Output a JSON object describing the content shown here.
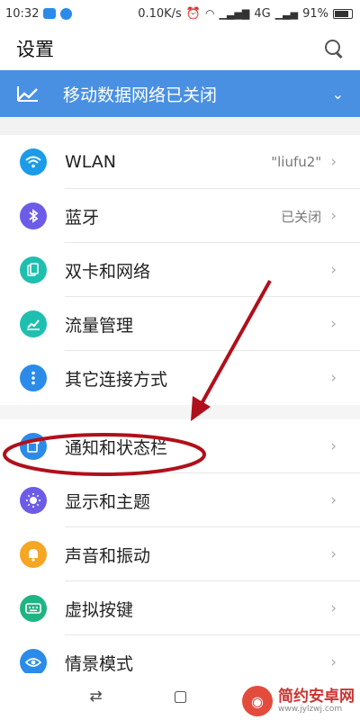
{
  "status_bar": {
    "time": "10:32",
    "speed": "0.10K/s",
    "network": "4G",
    "battery": "91%"
  },
  "header": {
    "title": "设置"
  },
  "banner": {
    "label": "移动数据网络已关闭"
  },
  "settings": {
    "items": [
      {
        "label": "WLAN",
        "value": "\"liufu2\"",
        "icon": "wifi-icon",
        "color": "#1b9be8"
      },
      {
        "label": "蓝牙",
        "value": "已关闭",
        "icon": "bluetooth-icon",
        "color": "#6c5ce7"
      },
      {
        "label": "双卡和网络",
        "value": "",
        "icon": "sim-icon",
        "color": "#1fbfb0"
      },
      {
        "label": "流量管理",
        "value": "",
        "icon": "chart-icon",
        "color": "#1fbfb0"
      },
      {
        "label": "其它连接方式",
        "value": "",
        "icon": "more-icon",
        "color": "#2b8be8"
      },
      {
        "label": "通知和状态栏",
        "value": "",
        "icon": "notification-icon",
        "color": "#2b8be8"
      },
      {
        "label": "显示和主题",
        "value": "",
        "icon": "brightness-icon",
        "color": "#6c5ce7"
      },
      {
        "label": "声音和振动",
        "value": "",
        "icon": "bell-icon",
        "color": "#f5a623"
      },
      {
        "label": "虚拟按键",
        "value": "",
        "icon": "keyboard-icon",
        "color": "#1fb582"
      },
      {
        "label": "情景模式",
        "value": "",
        "icon": "eye-icon",
        "color": "#2b8be8"
      }
    ]
  },
  "watermark": {
    "name": "简约安卓网",
    "url": "www.jylzwj.com"
  }
}
